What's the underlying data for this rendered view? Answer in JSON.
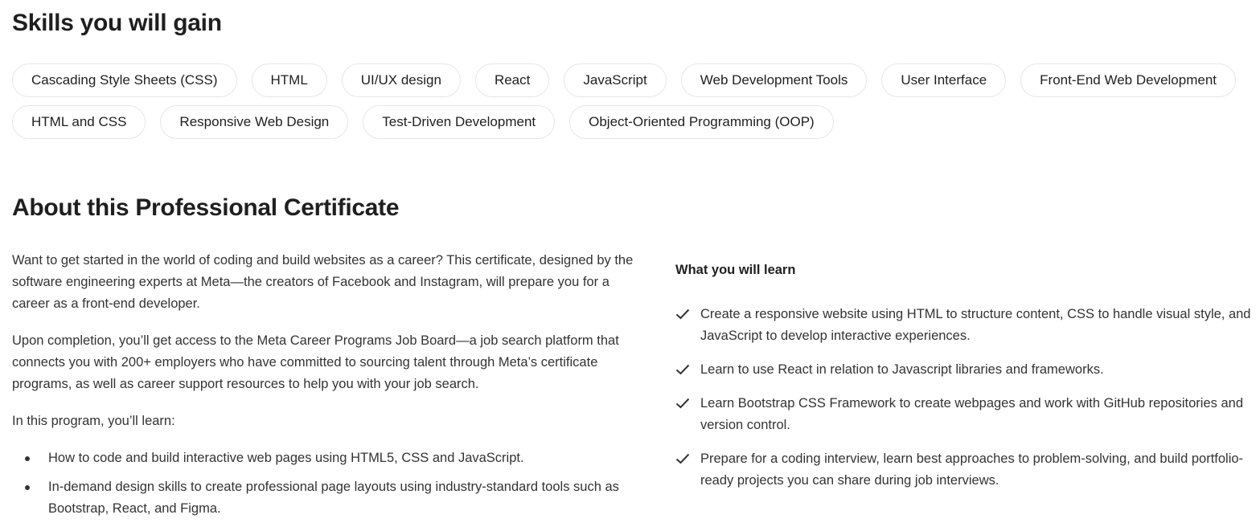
{
  "skills": {
    "title": "Skills you will gain",
    "items": [
      "Cascading Style Sheets (CSS)",
      "HTML",
      "UI/UX design",
      "React",
      "JavaScript",
      "Web Development Tools",
      "User Interface",
      "Front-End Web Development",
      "HTML and CSS",
      "Responsive Web Design",
      "Test-Driven Development",
      "Object-Oriented Programming (OOP)"
    ]
  },
  "about": {
    "title": "About this Professional Certificate",
    "paragraphs": [
      "Want to get started in the world of coding and build websites as a career? This certificate, designed by the software engineering experts at Meta—the creators of Facebook and Instagram, will prepare you for a career as a front-end developer.",
      "Upon completion, you’ll get access to the Meta Career Programs Job Board—a job search platform that connects you with 200+ employers who have committed to sourcing talent through Meta’s certificate programs, as well as career support resources to help you with your job search.",
      "In this program, you’ll learn:"
    ],
    "bullets": [
      "How to code and build interactive web pages using HTML5, CSS and JavaScript.",
      "In-demand design skills to create professional page layouts using industry-standard tools such as Bootstrap, React, and Figma."
    ]
  },
  "what_you_will_learn": {
    "title": "What you will learn",
    "icon": "check-icon",
    "items": [
      "Create a responsive website using HTML to structure content, CSS to handle visual style, and JavaScript to develop interactive experiences.",
      "Learn to use React in relation to Javascript libraries and frameworks.",
      "Learn Bootstrap CSS Framework to create webpages and work with GitHub repositories and version control.",
      "Prepare for a coding interview, learn best approaches to problem-solving, and build portfolio-ready projects you can share during job interviews."
    ]
  }
}
